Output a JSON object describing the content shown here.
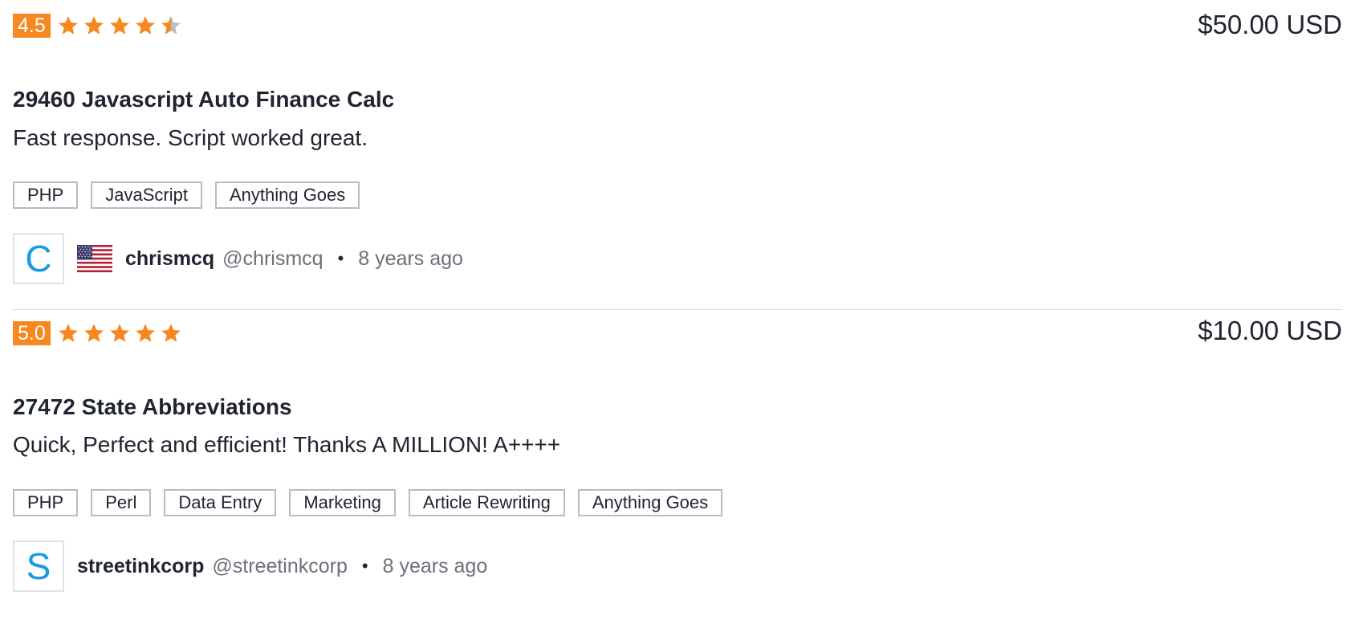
{
  "colors": {
    "accent": "#f7881f",
    "star_empty": "#b9bdc3",
    "avatar_letter": "#1a9ae0",
    "text": "#1f2430",
    "muted": "#6b7079"
  },
  "reviews": [
    {
      "rating": "4.5",
      "rating_value": 4.5,
      "price": "$50.00 USD",
      "title": "29460 Javascript Auto Finance Calc",
      "comment": "Fast response. Script worked great.",
      "tags": [
        "PHP",
        "JavaScript",
        "Anything Goes"
      ],
      "reviewer": {
        "avatar_letter": "C",
        "flag": "us-flag-icon",
        "username": "chrismcq",
        "handle": "@chrismcq",
        "separator": "•",
        "time": "8 years ago"
      }
    },
    {
      "rating": "5.0",
      "rating_value": 5.0,
      "price": "$10.00 USD",
      "title": "27472 State Abbreviations",
      "comment": "Quick, Perfect and efficient! Thanks A MILLION! A++++",
      "tags": [
        "PHP",
        "Perl",
        "Data Entry",
        "Marketing",
        "Article Rewriting",
        "Anything Goes"
      ],
      "reviewer": {
        "avatar_letter": "S",
        "username": "streetinkcorp",
        "handle": "@streetinkcorp",
        "separator": "•",
        "time": "8 years ago"
      }
    }
  ]
}
